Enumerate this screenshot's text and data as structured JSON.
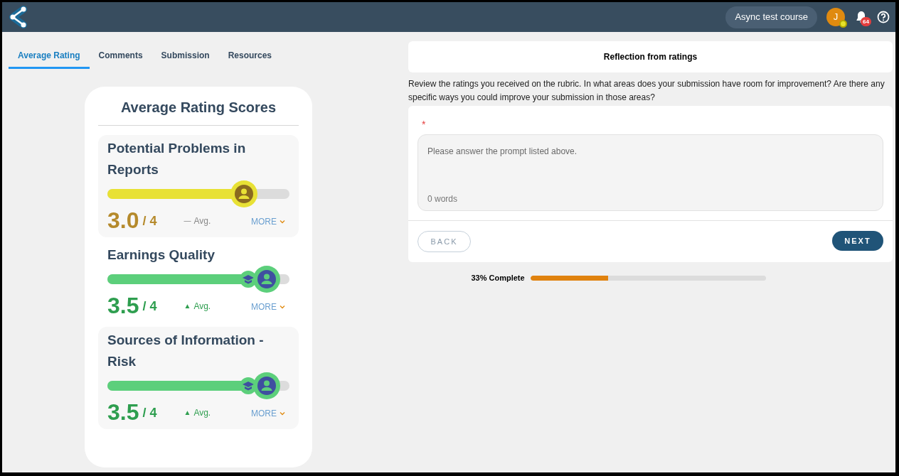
{
  "header": {
    "course": "Async test course",
    "avatar_initial": "J",
    "notifications": "64"
  },
  "tabs": [
    {
      "label": "Average Rating",
      "selected": true
    },
    {
      "label": "Comments",
      "selected": false
    },
    {
      "label": "Submission",
      "selected": false
    },
    {
      "label": "Resources",
      "selected": false
    }
  ],
  "ratings_card": {
    "title": "Average Rating Scores",
    "items": [
      {
        "name": "Potential Problems in Reports",
        "level": 0.75,
        "kind": "mid",
        "class_avg_marker": false,
        "score": "3.0",
        "out_of": "/ 4",
        "trend_icon": "—",
        "avg": "Avg.",
        "more": "MORE"
      },
      {
        "name": "Earnings Quality",
        "level": 0.875,
        "kind": "high",
        "class_avg_marker": true,
        "score": "3.5",
        "out_of": "/ 4",
        "trend_icon": "▲",
        "avg": "Avg.",
        "more": "MORE"
      },
      {
        "name": "Sources of Information - Risk",
        "level": 0.875,
        "kind": "high",
        "class_avg_marker": true,
        "score": "3.5",
        "out_of": "/ 4",
        "trend_icon": "▲",
        "avg": "Avg.",
        "more": "MORE"
      }
    ]
  },
  "reflection": {
    "title": "Reflection from ratings",
    "prompt": "Review the ratings you received on the rubric. In what areas does your submission have room for improvement? Are there any specific ways you could improve your submission in those areas?",
    "required_mark": "*",
    "placeholder": "Please answer the prompt listed above.",
    "word_count": "0 words",
    "back": {
      "label": "BACK",
      "disabled": true
    },
    "next": {
      "label": "NEXT",
      "disabled": false
    }
  },
  "progress": {
    "label": "33% Complete",
    "level": 0.33
  }
}
